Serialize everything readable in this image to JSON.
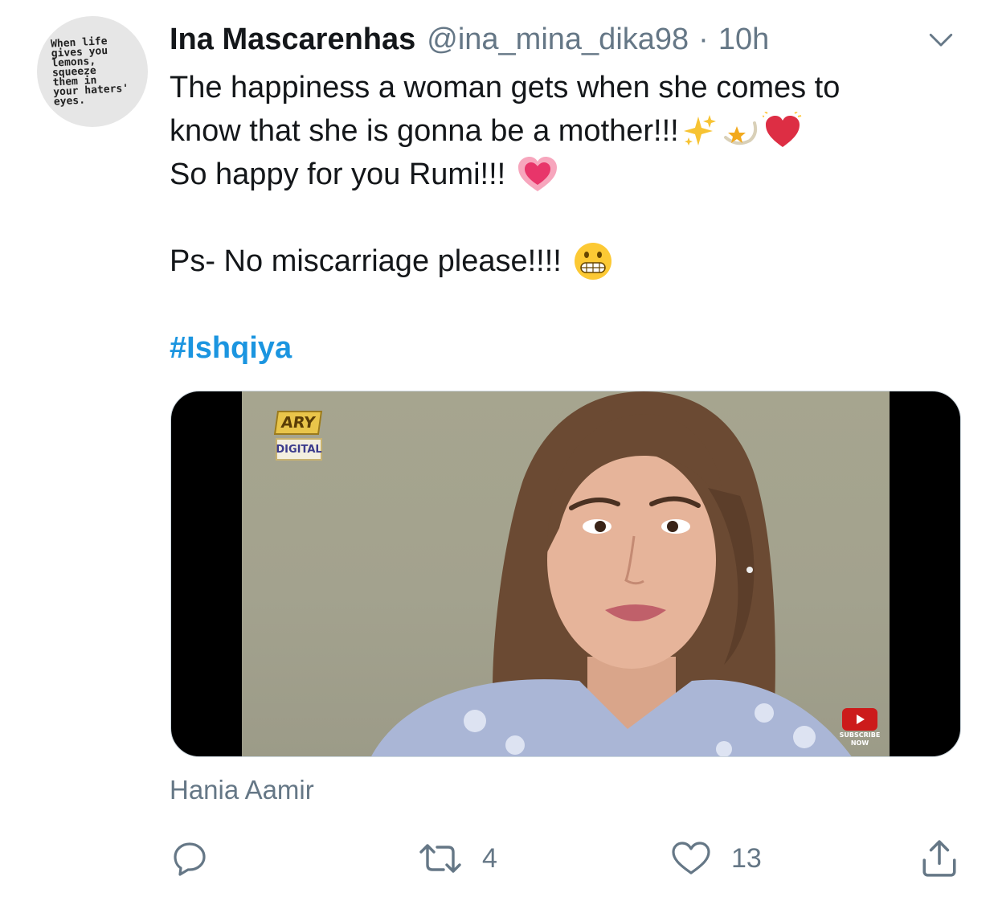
{
  "avatar": {
    "text": "When life\ngives you\nlemons,\nsqueeze\nthem in\nyour haters'\neyes."
  },
  "header": {
    "display_name": "Ina Mascarenhas",
    "handle": "@ina_mina_dika98",
    "separator": "·",
    "time": "10h",
    "menu_icon": "chevron-down-icon"
  },
  "tweet": {
    "line1": "The happiness a woman gets when she comes to",
    "line2": "know that she is gonna be a mother!!!",
    "line3": "So happy for you Rumi!!!",
    "line4": "Ps- No miscarriage please!!!!",
    "hashtag": "#Ishqiya",
    "emojis": [
      "sparkles",
      "dizzy-star",
      "beating-heart",
      "growing-heart",
      "grimacing-face"
    ]
  },
  "media": {
    "channel_logo_top": "ARY",
    "channel_logo_bottom": "DIGITAL",
    "subscribe_label_1": "SUBSCRIBE",
    "subscribe_label_2": "NOW"
  },
  "caption": "Hania Aamir",
  "actions": {
    "reply": {
      "icon": "reply-icon",
      "count": ""
    },
    "retweet": {
      "icon": "retweet-icon",
      "count": "4"
    },
    "like": {
      "icon": "heart-icon",
      "count": "13"
    },
    "share": {
      "icon": "share-icon",
      "count": ""
    }
  },
  "colors": {
    "link": "#1b95e0",
    "secondary_text": "#657786",
    "primary_text": "#14171a"
  }
}
